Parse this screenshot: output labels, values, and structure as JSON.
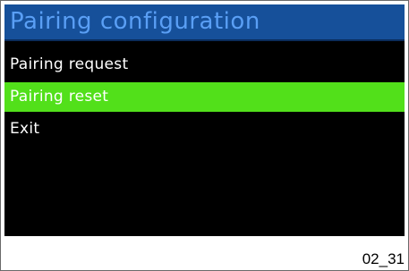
{
  "screen": {
    "title": "Pairing configuration",
    "menu": {
      "items": [
        {
          "label": "Pairing request",
          "selected": false
        },
        {
          "label": "Pairing reset",
          "selected": true
        },
        {
          "label": "Exit",
          "selected": false
        }
      ]
    }
  },
  "figure_id": "02_31",
  "colors": {
    "title_bar_bg": "#16509a",
    "title_text": "#5a9ff5",
    "screen_bg": "#000000",
    "selected_bg": "#52e01a",
    "menu_text": "#ffffff"
  }
}
